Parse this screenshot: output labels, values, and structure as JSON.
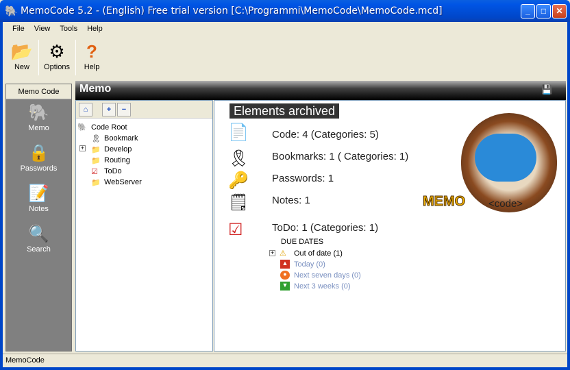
{
  "window": {
    "title": "MemoCode 5.2 - (English) Free trial version  [C:\\Programmi\\MemoCode\\MemoCode.mcd]",
    "min": "_",
    "max": "□",
    "close": "✕"
  },
  "menu": [
    "File",
    "View",
    "Tools",
    "Help"
  ],
  "toolbar": {
    "new": "New",
    "options": "Options",
    "help": "Help"
  },
  "leftnav": {
    "header": "Memo Code",
    "items": [
      "Memo",
      "Passwords",
      "Notes",
      "Search"
    ]
  },
  "panel_title": "Memo",
  "tree": {
    "root": "Code Root",
    "items": [
      "Bookmark",
      "Develop",
      "Routing",
      "ToDo",
      "WebServer"
    ]
  },
  "content": {
    "heading": "Elements archived",
    "stats": [
      "Code: 4 (Categories: 5)",
      "Bookmarks: 1 ( Categories: 1)",
      "Passwords: 1",
      "Notes: 1",
      "ToDo: 1 (Categories: 1)"
    ],
    "due_title": "DUE DATES",
    "due": [
      "Out of date  (1)",
      "Today  (0)",
      "Next seven days  (0)",
      "Next 3 weeks  (0)"
    ],
    "logo_text": "MEMO <code>"
  },
  "status": "MemoCode"
}
